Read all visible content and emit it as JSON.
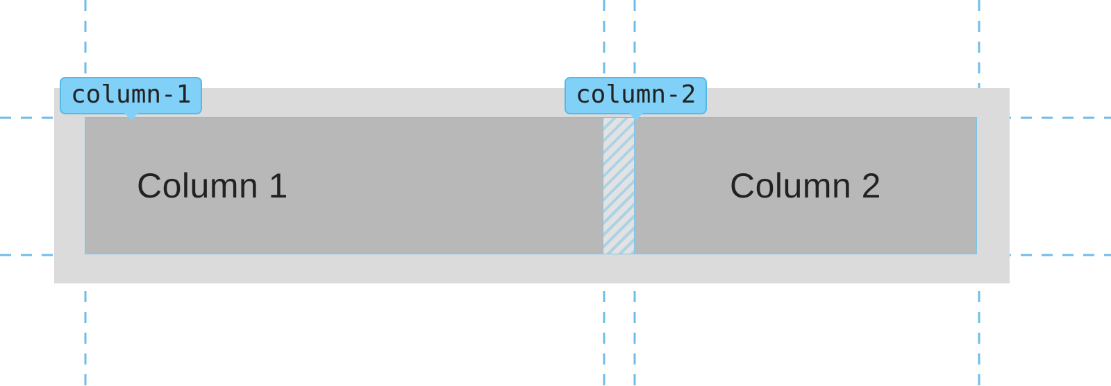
{
  "grid": {
    "columns": [
      {
        "track_name": "column-1",
        "content_label": "Column 1"
      },
      {
        "track_name": "column-2",
        "content_label": "Column 2"
      }
    ]
  },
  "colors": {
    "container_bg": "#dbdbdb",
    "cell_bg": "#b8b8b8",
    "overlay_accent": "#80d0f7",
    "guide_line": "#6fbce9"
  }
}
